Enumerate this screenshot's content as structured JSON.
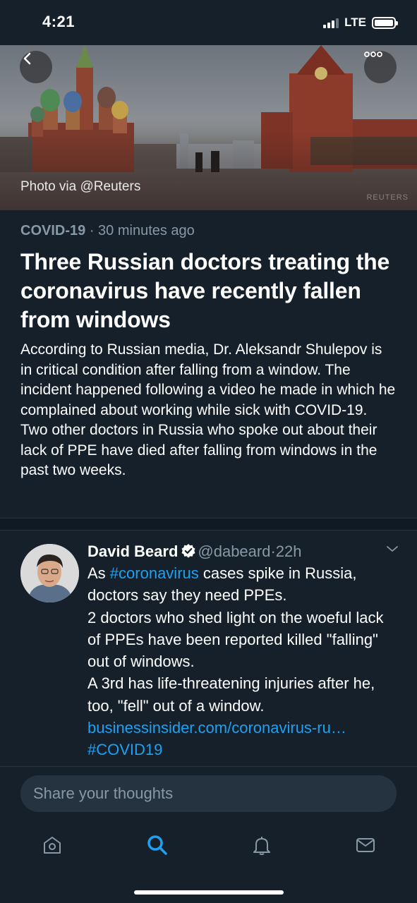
{
  "status_bar": {
    "time": "4:21",
    "network": "LTE"
  },
  "hero": {
    "photo_credit": "Photo via @Reuters",
    "watermark": "REUTERS",
    "back_icon": "chevron-left-icon",
    "more_icon": "more-horizontal-icon"
  },
  "article": {
    "topic": "COVID-19",
    "separator": "·",
    "age": "30 minutes ago",
    "headline": "Three Russian doctors treating the coronavirus have recently fallen from windows",
    "summary": "According to Russian media, Dr. Aleksandr Shulepov is in critical condition after falling from a window. The incident happened following a video he made in which he complained about working while sick with COVID-19. Two other doctors in Russia who spoke out about their lack of PPE have died after falling from windows in the past two weeks."
  },
  "tweet": {
    "author_name": "David Beard",
    "handle": "@dabeard",
    "separator": "·",
    "time": "22h",
    "text_line1_pre": "As ",
    "hashtag1": "#coronavirus",
    "text_line1_post": " cases spike in Russia, doctors say they need PPEs.",
    "text_line2": "2 doctors who shed light on the woeful lack of PPEs have been reported killed \"falling\" out of windows.",
    "text_line3": "A 3rd has life-threatening injuries after he, too, \"fell\" out of a window.",
    "link": "businessinsider.com/coronavirus-ru…",
    "hashtag2": "#COVID19"
  },
  "compose": {
    "placeholder": "Share your thoughts"
  },
  "tabbar": {
    "items": [
      {
        "name": "home",
        "icon": "home-icon",
        "active": false
      },
      {
        "name": "search",
        "icon": "search-icon",
        "active": true
      },
      {
        "name": "notifications",
        "icon": "bell-icon",
        "active": false
      },
      {
        "name": "messages",
        "icon": "mail-icon",
        "active": false
      }
    ]
  },
  "colors": {
    "background": "#15202b",
    "accent": "#1da1f2",
    "secondary_text": "#8899a6",
    "divider": "#253341"
  }
}
